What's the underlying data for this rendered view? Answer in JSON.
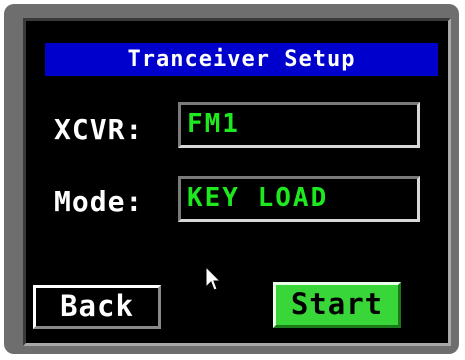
{
  "window": {
    "title": "Tranceiver Setup"
  },
  "fields": {
    "xcvr": {
      "label": "XCVR:",
      "value": "FM1"
    },
    "mode": {
      "label": "Mode:",
      "value": "KEY LOAD"
    }
  },
  "buttons": {
    "back_label": "Back",
    "start_label": "Start"
  },
  "colors": {
    "title_bar": "#0000cc",
    "screen_bg": "#000000",
    "value_text": "#1ee81e",
    "start_button": "#39d639",
    "bezel": "#6e6e6e"
  },
  "icons": {
    "pointer": "mouse-pointer-icon"
  }
}
